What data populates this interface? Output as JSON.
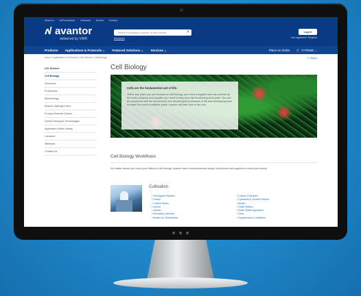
{
  "header": {
    "utility": [
      "About us",
      "All Promotions",
      "Literature",
      "Events",
      "Contact"
    ],
    "logo_word": "avantor",
    "logo_sub": "delivered by VWR",
    "search_placeholder": "Search by keyword, supplier, or part number",
    "advanced": "Advanced",
    "login": "Log in",
    "register": "Not registered? Register"
  },
  "nav": {
    "left": [
      "Products",
      "Applications & Protocols ⌄",
      "Featured Solutions ⌄",
      "Services ⌄"
    ],
    "place_order": "Place An Order",
    "cart": "0 ITEMS ⌄"
  },
  "breadcrumb": "Home \\ Applications & Protocols \\ Life Science \\ Cell Biology",
  "share": "Share",
  "sidebar": {
    "items": [
      "Life Science",
      "Cell Biology",
      "Genomics",
      "Proteomics",
      "Microbiology",
      "Avantor Sartorigm Sero",
      "Product Selector Guides",
      "Oxford Nanopore Technologies",
      "Application Notes Library",
      "Literature",
      "Webinars",
      "Contact Us"
    ]
  },
  "main": {
    "title": "Cell Biology",
    "hero_heading": "Cells are the fundamental unit of life.",
    "hero_body": "That's why when you are focused on cell biology, you need a supplier who can provide all the tools, products and supplies you need to keep your lab functioning at its peak. You can be concerned with the biochemical and physiological processes of life and developing tools to make the world a healthier place. Avantor will take care of the rest.",
    "workflows_title": "Cell Biology Workflows",
    "workflows_intro": "No matter where you focus your efforts in cell biology, Avantor has a comprehensive range of products and supplies to meet your needs.",
    "cultivation_title": "Cultivation",
    "links_col1": [
      "Serological Pipettes",
      "Flasks",
      "Culture Plates",
      "Inserts",
      "Dishes",
      "BioSafety Cabinets",
      "Bottles for Sera/Media"
    ],
    "links_col2": [
      "Culture Chambers",
      "Cytokines & Growth Factors",
      "Media",
      "Roller Bottles",
      "Roller Bottle Apparatus",
      "Sera",
      "Supplements & Additives"
    ]
  }
}
